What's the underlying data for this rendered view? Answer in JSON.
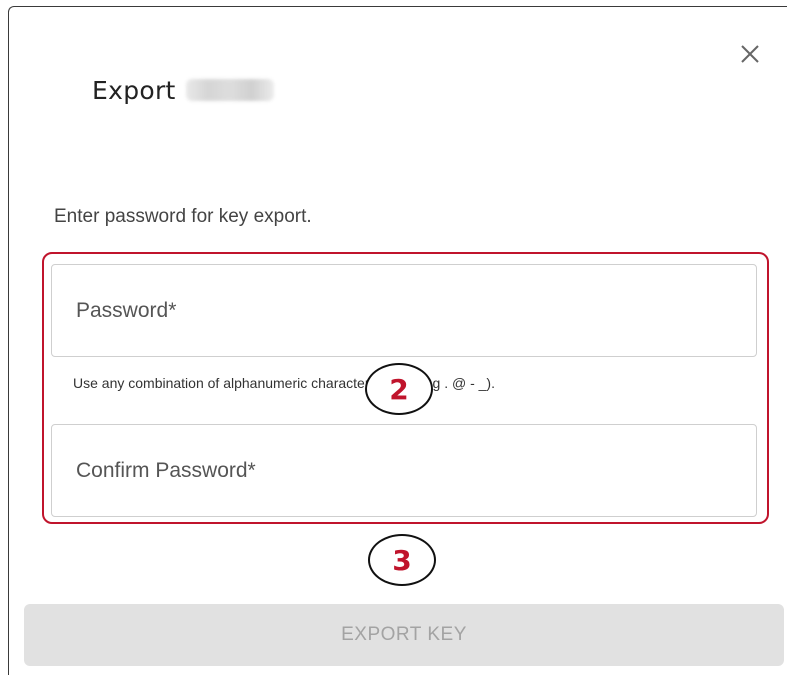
{
  "dialog": {
    "title": "Export",
    "close_icon": "close-icon",
    "instruction": "Enter password for key export."
  },
  "form": {
    "password": {
      "placeholder": "Password*",
      "value": ""
    },
    "helper_text": "Use any combination of alphanumeric characters (including . @ - _).",
    "confirm_password": {
      "placeholder": "Confirm Password*",
      "value": ""
    }
  },
  "annotations": {
    "callout_2": "2",
    "callout_3": "3",
    "highlight_color": "#c0142c"
  },
  "actions": {
    "export_label": "EXPORT KEY",
    "export_enabled": false
  }
}
